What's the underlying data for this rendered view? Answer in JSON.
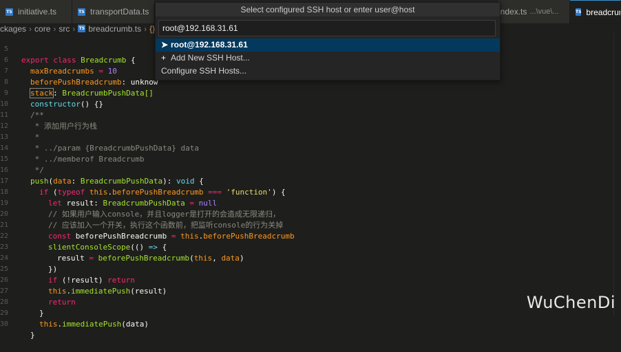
{
  "tabs": [
    {
      "label": "initiative.ts",
      "path": ""
    },
    {
      "label": "transportData.ts",
      "path": ""
    },
    {
      "label": "index.ts",
      "path": "...\\vue\\..."
    },
    {
      "label": "breadcrum",
      "path": ""
    }
  ],
  "breadcrumb": {
    "items": [
      "ckages",
      "core",
      "src",
      "breadcrumb.ts",
      "{}"
    ],
    "file_icon": "ts"
  },
  "quickpick": {
    "title": "Select configured SSH host or enter user@host",
    "input_value": "root@192.168.31.61",
    "items": [
      {
        "label": "root@192.168.31.61",
        "icon": "arrow-right-icon"
      },
      {
        "label": "Add New SSH Host...",
        "icon": "plus-icon"
      },
      {
        "label": "Configure SSH Hosts...",
        "icon": ""
      }
    ]
  },
  "editor": {
    "line_numbers": [
      "5",
      "6",
      "7",
      "8",
      "9",
      "10",
      "11",
      "12",
      "13",
      "14",
      "15",
      "16",
      "17",
      "18",
      "19",
      "20",
      "21",
      "22",
      "23",
      "24",
      "25",
      "26",
      "27",
      "28",
      "29",
      "30"
    ]
  },
  "code": {
    "l5_kw": "export class ",
    "l5_name": "Breadcrumb",
    "l5_rest": " {",
    "l6_prop": "maxBreadcrumbs",
    "l6_rest": " = ",
    "l6_num": "10",
    "l7_prop": "beforePushBreadcrumb",
    "l7_rest": ": unknow",
    "l8_prop": "stack",
    "l8_rest": ": ",
    "l8_type": "BreadcrumbPushData[]",
    "l9_fn": "constructor",
    "l9_rest": "() {}",
    "l10": "/**",
    "l11": " * 添加用户行为栈",
    "l12": " *",
    "l13": " * ../param {BreadcrumbPushData} data",
    "l14": " * ../memberof Breadcrumb",
    "l15": " */",
    "l16_fn": "push",
    "l16_a": "(",
    "l16_arg": "data",
    "l16_b": ": ",
    "l16_type": "BreadcrumbPushData",
    "l16_c": "): ",
    "l16_void": "void",
    "l16_d": " {",
    "l17_kw": "if",
    "l17_a": " (",
    "l17_typeof": "typeof",
    "l17_this": " this",
    "l17_b": ".",
    "l17_prop": "beforePushBreadcrumb",
    "l17_op": " === ",
    "l17_str": "'function'",
    "l17_c": ") {",
    "l18_kw": "let",
    "l18_a": " result: ",
    "l18_type": "BreadcrumbPushData",
    "l18_op": " = ",
    "l18_null": "null",
    "l19": "// 如果用户输入console，并且logger是打开的会造成无限递归，",
    "l20": "// 应该加入一个开关，执行这个函数前，把监听console的行为关掉",
    "l21_kw": "const",
    "l21_a": " beforePushBreadcrumb ",
    "l21_op": "=",
    "l21_this": " this",
    "l21_b": ".",
    "l21_prop": "beforePushBreadcrumb",
    "l22_fn": "slientConsoleScope",
    "l22_a": "(() ",
    "l22_op": "=>",
    "l22_b": " {",
    "l23_a": "result ",
    "l23_op": "=",
    "l23_fn": " beforePushBreadcrumb",
    "l23_b": "(",
    "l23_this": "this",
    "l23_c": ", ",
    "l23_arg": "data",
    "l23_d": ")",
    "l24": "})",
    "l25_kw": "if",
    "l25_a": " (!result) ",
    "l25_ret": "return",
    "l26_this": "this",
    "l26_a": ".",
    "l26_fn": "immediatePush",
    "l26_b": "(result)",
    "l27_ret": "return",
    "l28": "}",
    "l29_this": "this",
    "l29_a": ".",
    "l29_fn": "immediatePush",
    "l29_b": "(data)",
    "l30": "}"
  },
  "watermark": "WuChenDi"
}
